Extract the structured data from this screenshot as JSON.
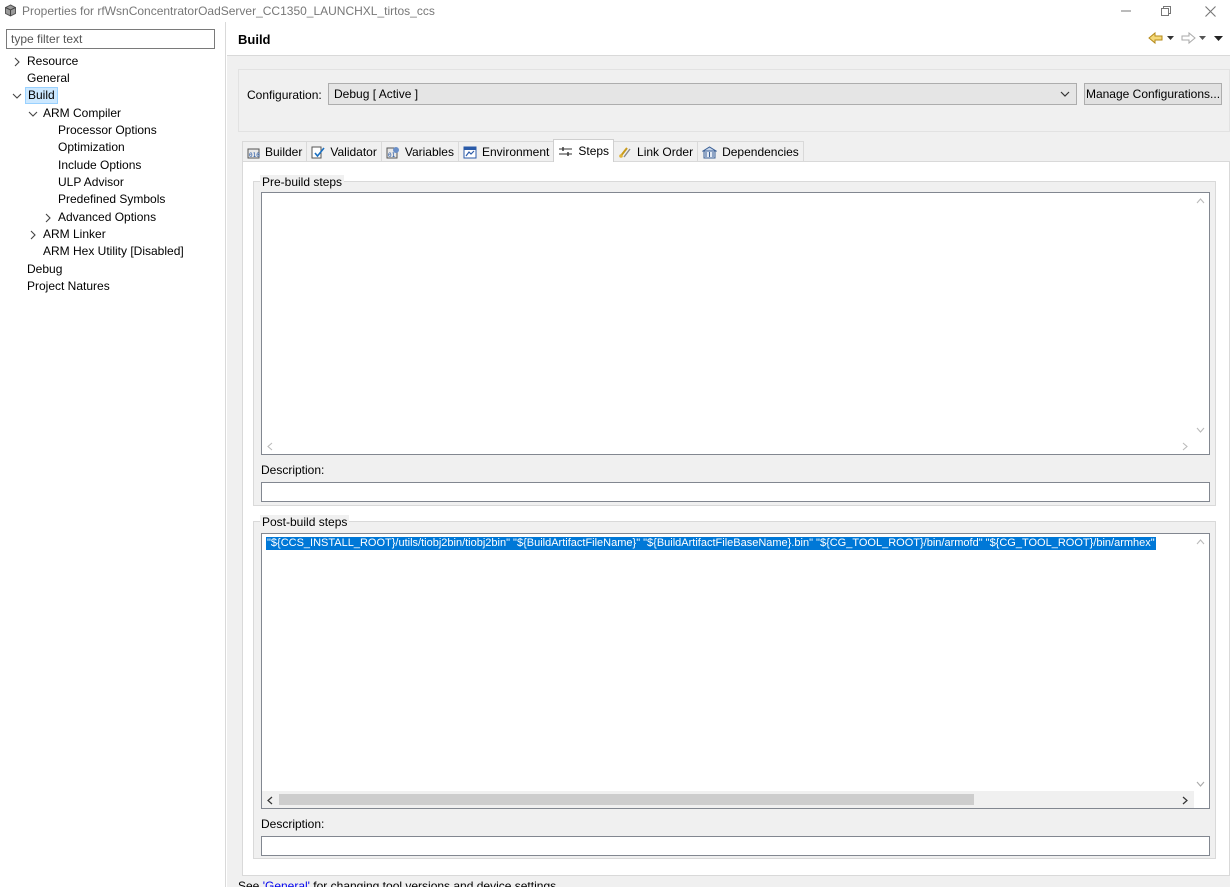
{
  "window": {
    "title": "Properties for rfWsnConcentratorOadServer_CC1350_LAUNCHXL_tirtos_ccs"
  },
  "filter": {
    "placeholder": "type filter text"
  },
  "tree": {
    "resource": "Resource",
    "general": "General",
    "build": "Build",
    "arm_compiler": "ARM Compiler",
    "processor_options": "Processor Options",
    "optimization": "Optimization",
    "include_options": "Include Options",
    "ulp_advisor": "ULP Advisor",
    "predefined_symbols": "Predefined Symbols",
    "advanced_options": "Advanced Options",
    "arm_linker": "ARM Linker",
    "arm_hex_utility": "ARM Hex Utility  [Disabled]",
    "debug": "Debug",
    "project_natures": "Project Natures"
  },
  "page": {
    "title": "Build"
  },
  "config": {
    "label": "Configuration:",
    "selected": "Debug  [ Active ]",
    "manage_button": "Manage Configurations..."
  },
  "tabs": {
    "builder": "Builder",
    "validator": "Validator",
    "variables": "Variables",
    "environment": "Environment",
    "steps": "Steps",
    "link_order": "Link Order",
    "dependencies": "Dependencies",
    "active": "Steps"
  },
  "prebuild": {
    "title": "Pre-build steps",
    "command": "",
    "description_label": "Description:",
    "description": ""
  },
  "postbuild": {
    "title": "Post-build steps",
    "command": "\"${CCS_INSTALL_ROOT}/utils/tiobj2bin/tiobj2bin\" \"${BuildArtifactFileName}\" \"${BuildArtifactFileBaseName}.bin\" \"${CG_TOOL_ROOT}/bin/armofd\" \"${CG_TOOL_ROOT}/bin/armhex\"",
    "description_label": "Description:",
    "description": ""
  },
  "footer": {
    "prefix": "See ",
    "link": "'General'",
    "suffix": " for changing tool versions and device settings"
  },
  "colors": {
    "selection": "#0078d7",
    "tree_selection": "#cce8ff",
    "panel_bg": "#f0f0f0"
  }
}
